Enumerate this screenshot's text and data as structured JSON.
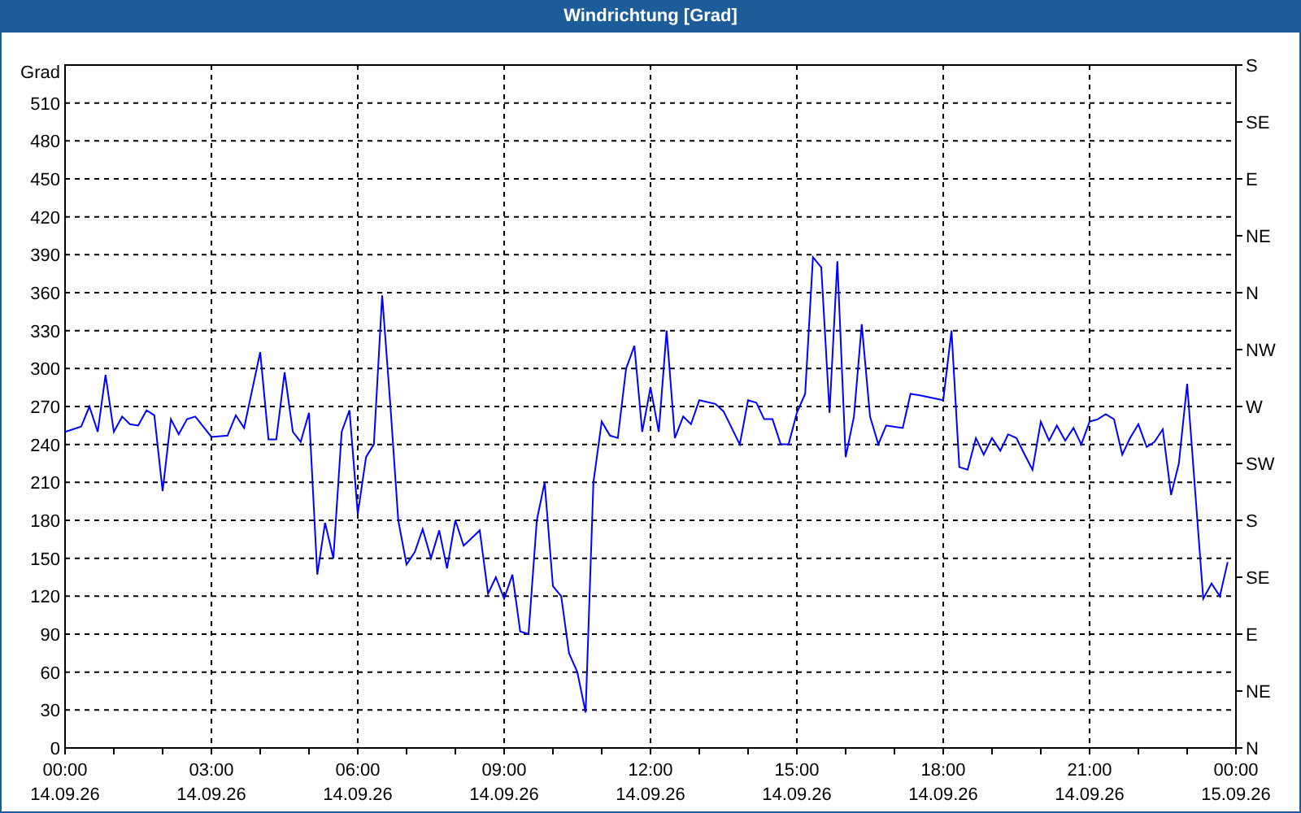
{
  "window": {
    "title": "Windrichtung [Grad]"
  },
  "chart": {
    "x_dates": [
      "14.09.26",
      "14.09.26",
      "14.09.26",
      "14.09.26",
      "14.09.26",
      "14.09.26",
      "14.09.26",
      "14.09.26",
      "15.09.26"
    ],
    "right_yticks": [
      "S",
      "SE",
      "E",
      "NE",
      "N",
      "NW",
      "W",
      "SW",
      "S",
      "SE",
      "E",
      "NE",
      "N"
    ],
    "chart_data": {
      "type": "line",
      "grid": true,
      "ylabel": "Grad",
      "xlim": [
        0,
        24
      ],
      "ylim": [
        0,
        540
      ],
      "xticks": [
        {
          "value": 0,
          "label": "00:00"
        },
        {
          "value": 3,
          "label": "03:00"
        },
        {
          "value": 6,
          "label": "06:00"
        },
        {
          "value": 9,
          "label": "09:00"
        },
        {
          "value": 12,
          "label": "12:00"
        },
        {
          "value": 15,
          "label": "15:00"
        },
        {
          "value": 18,
          "label": "18:00"
        },
        {
          "value": 21,
          "label": "21:00"
        },
        {
          "value": 24,
          "label": "00:00"
        }
      ],
      "yticks": [
        0,
        30,
        60,
        90,
        120,
        150,
        180,
        210,
        240,
        270,
        300,
        330,
        360,
        390,
        420,
        450,
        480,
        510
      ],
      "x": [
        0,
        0.33,
        0.5,
        0.67,
        0.83,
        1,
        1.17,
        1.33,
        1.5,
        1.67,
        1.83,
        2,
        2.17,
        2.33,
        2.5,
        2.67,
        3,
        3.33,
        3.5,
        3.67,
        4,
        4.17,
        4.33,
        4.5,
        4.67,
        4.83,
        5,
        5.17,
        5.33,
        5.5,
        5.67,
        5.83,
        6,
        6.17,
        6.33,
        6.5,
        6.67,
        6.83,
        7,
        7.17,
        7.33,
        7.5,
        7.67,
        7.83,
        8,
        8.17,
        8.5,
        8.67,
        8.83,
        9,
        9.17,
        9.33,
        9.5,
        9.67,
        9.83,
        10,
        10.17,
        10.33,
        10.5,
        10.67,
        10.83,
        11,
        11.17,
        11.33,
        11.5,
        11.67,
        11.83,
        12,
        12.17,
        12.33,
        12.5,
        12.67,
        12.83,
        13,
        13.33,
        13.5,
        13.83,
        14,
        14.17,
        14.33,
        14.5,
        14.67,
        14.83,
        15,
        15.17,
        15.33,
        15.5,
        15.67,
        15.83,
        16,
        16.17,
        16.33,
        16.5,
        16.67,
        16.83,
        17.17,
        17.33,
        17.5,
        18,
        18.17,
        18.33,
        18.5,
        18.67,
        18.83,
        19,
        19.17,
        19.33,
        19.5,
        19.67,
        19.83,
        20,
        20.17,
        20.33,
        20.5,
        20.67,
        20.83,
        21,
        21.17,
        21.33,
        21.5,
        21.67,
        21.83,
        22,
        22.17,
        22.33,
        22.5,
        22.67,
        22.83,
        23,
        23.17,
        23.33,
        23.5,
        23.67,
        23.83
      ],
      "series": [
        {
          "color": "#0000ff",
          "values": [
            250,
            254,
            270,
            250,
            295,
            250,
            262,
            256,
            255,
            267,
            263,
            203,
            260,
            248,
            260,
            262,
            246,
            247,
            263,
            253,
            313,
            244,
            244,
            297,
            250,
            242,
            265,
            137,
            178,
            150,
            250,
            267,
            185,
            230,
            240,
            358,
            270,
            180,
            145,
            155,
            173,
            150,
            172,
            142,
            180,
            160,
            172,
            122,
            135,
            118,
            137,
            92,
            90,
            180,
            210,
            128,
            120,
            75,
            60,
            28,
            210,
            258,
            247,
            245,
            300,
            318,
            250,
            285,
            250,
            330,
            245,
            262,
            256,
            275,
            272,
            266,
            240,
            275,
            273,
            260,
            260,
            240,
            240,
            265,
            280,
            388,
            380,
            265,
            385,
            230,
            262,
            335,
            262,
            240,
            255,
            253,
            280,
            279,
            275,
            330,
            222,
            220,
            245,
            232,
            245,
            235,
            248,
            245,
            232,
            220,
            258,
            243,
            255,
            243,
            253,
            240,
            258,
            260,
            264,
            260,
            232,
            245,
            256,
            238,
            242,
            252,
            200,
            225,
            288,
            200,
            118,
            130,
            120,
            147
          ]
        }
      ]
    }
  }
}
